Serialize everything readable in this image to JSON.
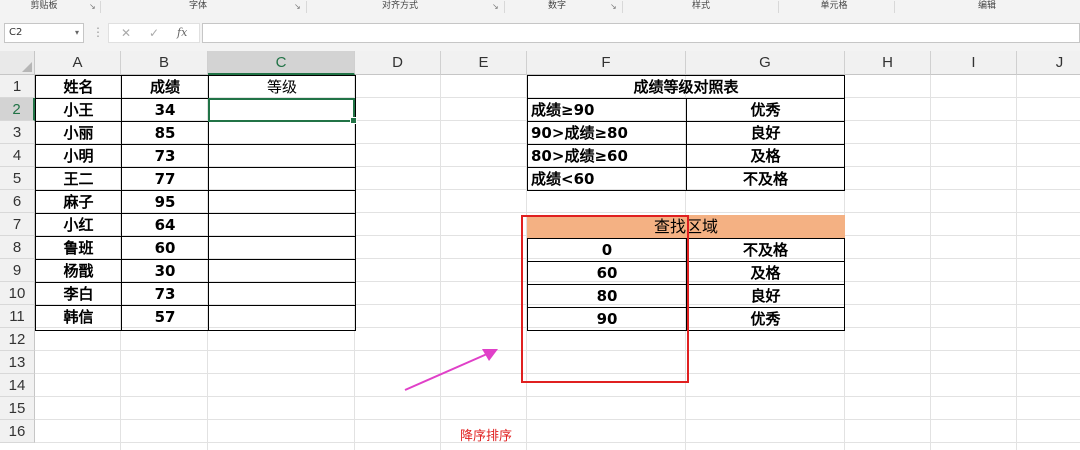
{
  "ribbon": {
    "groups": [
      "剪贴板",
      "字体",
      "对齐方式",
      "数字",
      "样式",
      "单元格",
      "编辑"
    ],
    "launcher_glyph": "↘"
  },
  "formula_bar": {
    "name_box": "C2",
    "name_box_caret": "▾",
    "dots": "⋮",
    "cancel": "✕",
    "enter": "✓",
    "fx": "fx",
    "formula": ""
  },
  "sheet": {
    "columns": [
      "A",
      "B",
      "C",
      "D",
      "E",
      "F",
      "G",
      "H",
      "I",
      "J"
    ],
    "rows": [
      "1",
      "2",
      "3",
      "4",
      "5",
      "6",
      "7",
      "8",
      "9",
      "10",
      "11",
      "12",
      "13",
      "14",
      "15",
      "16"
    ],
    "selected_cell": "C2",
    "main_table": {
      "headers": [
        "姓名",
        "成绩",
        "等级"
      ],
      "rows": [
        [
          "小王",
          "34",
          ""
        ],
        [
          "小丽",
          "85",
          ""
        ],
        [
          "小明",
          "73",
          ""
        ],
        [
          "王二",
          "77",
          ""
        ],
        [
          "麻子",
          "95",
          ""
        ],
        [
          "小红",
          "64",
          ""
        ],
        [
          "鲁班",
          "60",
          ""
        ],
        [
          "杨戬",
          "30",
          ""
        ],
        [
          "李白",
          "73",
          ""
        ],
        [
          "韩信",
          "57",
          ""
        ]
      ]
    },
    "grade_table": {
      "title": "成绩等级对照表",
      "rows": [
        [
          "成绩≥90",
          "优秀"
        ],
        [
          "90>成绩≥80",
          "良好"
        ],
        [
          "80>成绩≥60",
          "及格"
        ],
        [
          "成绩<60",
          "不及格"
        ]
      ]
    },
    "lookup_table": {
      "title": "查找区域",
      "rows": [
        [
          "0",
          "不及格"
        ],
        [
          "60",
          "及格"
        ],
        [
          "80",
          "良好"
        ],
        [
          "90",
          "优秀"
        ]
      ]
    }
  },
  "annotation": {
    "text": "降序排序",
    "color": "#e02020"
  },
  "colors": {
    "excel_green": "#217346",
    "lookup_header_bg": "#f4b183",
    "highlight_red": "#e02020",
    "arrow_magenta": "#e040c8"
  }
}
